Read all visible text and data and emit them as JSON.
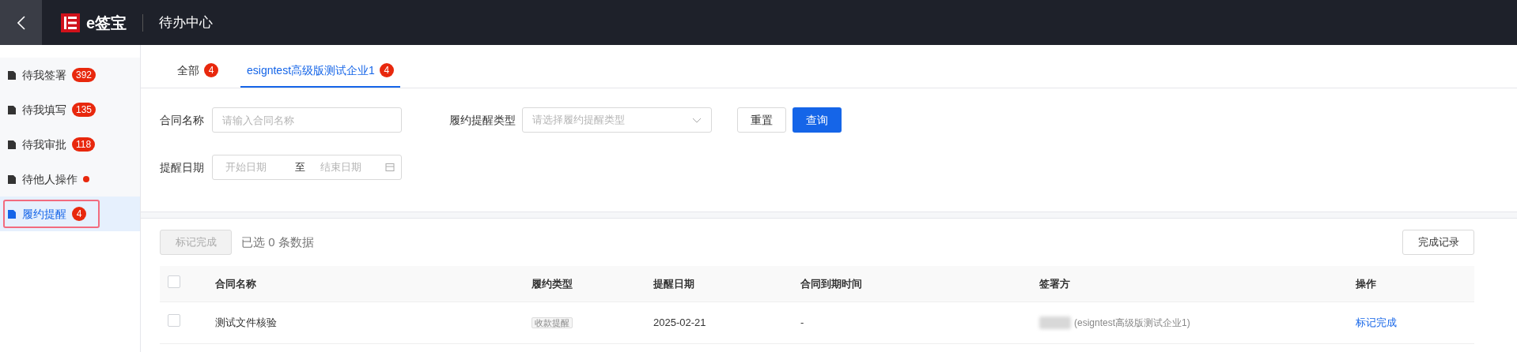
{
  "header": {
    "logo_text": "e签宝",
    "title": "待办中心"
  },
  "sidebar": {
    "items": [
      {
        "label": "待我签署",
        "badge": "392",
        "kind": "count",
        "selected": false
      },
      {
        "label": "待我填写",
        "badge": "135",
        "kind": "count",
        "selected": false
      },
      {
        "label": "待我审批",
        "badge": "118",
        "kind": "count",
        "selected": false
      },
      {
        "label": "待他人操作",
        "kind": "dot",
        "selected": false
      },
      {
        "label": "履约提醒",
        "badge": "4",
        "kind": "count",
        "selected": true
      }
    ]
  },
  "tabs": [
    {
      "label": "全部",
      "badge": "4",
      "selected": false
    },
    {
      "label": "esigntest高级版测试企业1",
      "badge": "4",
      "selected": true
    }
  ],
  "filters": {
    "contract_name": {
      "label": "合同名称",
      "placeholder": "请输入合同名称"
    },
    "reminder_type": {
      "label": "履约提醒类型",
      "placeholder": "请选择履约提醒类型"
    },
    "reminder_date": {
      "label": "提醒日期",
      "start_placeholder": "开始日期",
      "separator": "至",
      "end_placeholder": "结束日期"
    },
    "buttons": [
      "重置",
      "查询"
    ]
  },
  "toolbar": {
    "mark_button": "标记完成",
    "selection_info": "已选 0 条数据",
    "records_button": "完成记录"
  },
  "table": {
    "select_all_checked": false,
    "columns": [
      "合同名称",
      "履约类型",
      "提醒日期",
      "合同到期时间",
      "签署方",
      "操作"
    ],
    "rows": [
      {
        "checked": false,
        "name": "测试文件核验",
        "type": "收款提醒",
        "date": "2025-02-21",
        "expiry": "-",
        "signer": "(esigntest高级版测试企业1)",
        "action": "标记完成"
      }
    ]
  }
}
